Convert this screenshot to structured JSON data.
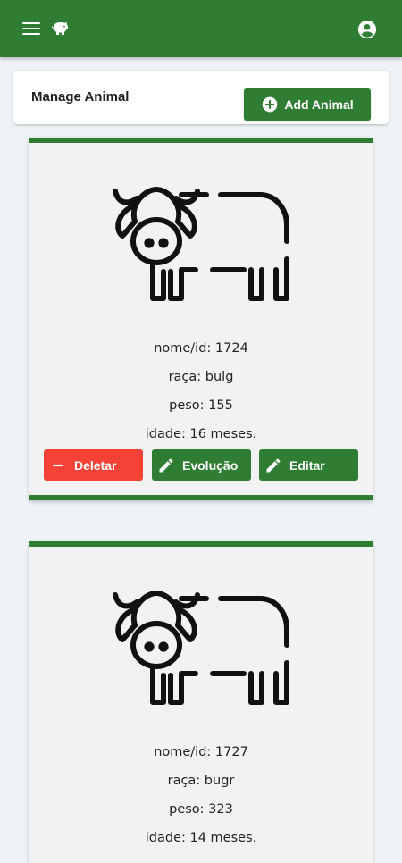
{
  "appbar": {
    "menu_icon": "menu-icon",
    "logo_icon": "piggy-bank-icon",
    "account_icon": "account-circle-icon",
    "color": "#2e7d32"
  },
  "manage": {
    "title": "Manage Animal",
    "add_button": "Add Animal"
  },
  "animals": [
    {
      "icon": "cow-icon",
      "nome": "nome/id: 1724",
      "raca": "raça: bulg",
      "peso": "peso: 155",
      "idade": "idade: 16 meses.",
      "buttons": {
        "delete": "Deletar",
        "evolution": "Evolução",
        "edit": "Editar"
      }
    },
    {
      "icon": "cow-icon",
      "nome": "nome/id: 1727",
      "raca": "raça: bugr",
      "peso": "peso: 323",
      "idade": "idade: 14 meses."
    }
  ],
  "colors": {
    "primary": "#2e7d32",
    "danger": "#f44336",
    "background": "#eef3f7",
    "card": "#f2f2f2"
  }
}
